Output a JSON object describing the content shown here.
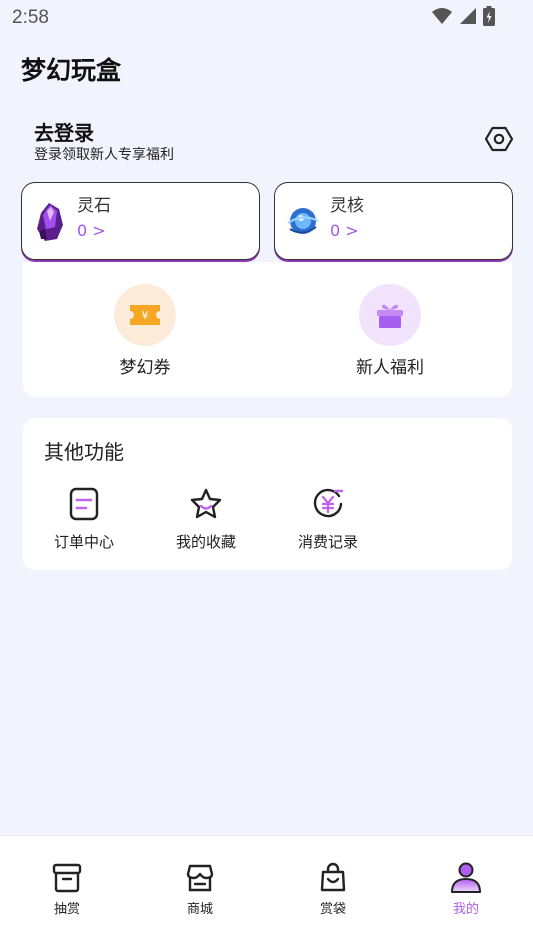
{
  "status_bar": {
    "time": "2:58"
  },
  "app": {
    "title": "梦幻玩盒"
  },
  "login": {
    "title": "去登录",
    "subtitle": "登录领取新人专享福利"
  },
  "wallet": [
    {
      "name": "灵石",
      "value": "0 >",
      "icon": "purple-crystal-icon"
    },
    {
      "name": "灵核",
      "value": "0 >",
      "icon": "blue-core-icon"
    }
  ],
  "perks": [
    {
      "label": "梦幻券",
      "icon": "ticket-icon",
      "color": "#f5a623"
    },
    {
      "label": "新人福利",
      "icon": "gift-icon",
      "color": "#b06cf0"
    }
  ],
  "other": {
    "title": "其他功能",
    "items": [
      {
        "label": "订单中心",
        "icon": "order-icon"
      },
      {
        "label": "我的收藏",
        "icon": "star-icon"
      },
      {
        "label": "消费记录",
        "icon": "yuan-record-icon"
      }
    ]
  },
  "tabs": [
    {
      "label": "抽赏",
      "icon": "box-icon",
      "active": false
    },
    {
      "label": "商城",
      "icon": "store-icon",
      "active": false
    },
    {
      "label": "赏袋",
      "icon": "bag-icon",
      "active": false
    },
    {
      "label": "我的",
      "icon": "profile-icon",
      "active": true
    }
  ],
  "colors": {
    "accent": "#b25ef0",
    "background": "#f2f4fd"
  }
}
